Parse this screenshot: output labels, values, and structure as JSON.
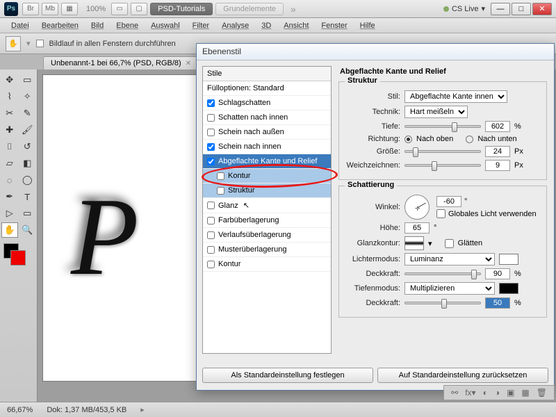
{
  "titlebar": {
    "zoom": "100%",
    "workspace_active": "PSD-Tutorials",
    "workspace_other": "Grundelemente",
    "cslive": "CS Live"
  },
  "menu": [
    "Datei",
    "Bearbeiten",
    "Bild",
    "Ebene",
    "Auswahl",
    "Filter",
    "Analyse",
    "3D",
    "Ansicht",
    "Fenster",
    "Hilfe"
  ],
  "options": {
    "scroll_all": "Bildlauf in allen Fenstern durchführen"
  },
  "doc": {
    "tab": "Unbenannt-1 bei 66,7% (PSD, RGB/8)"
  },
  "dialog": {
    "title": "Ebenenstil",
    "list_header": "Stile",
    "fill_opts": "Fülloptionen: Standard",
    "items": {
      "drop_shadow": "Schlagschatten",
      "inner_shadow": "Schatten nach innen",
      "outer_glow": "Schein nach außen",
      "inner_glow": "Schein nach innen",
      "bevel": "Abgeflachte Kante und Relief",
      "contour_sub": "Kontur",
      "texture_sub": "Struktur",
      "satin": "Glanz",
      "color_overlay": "Farbüberlagerung",
      "grad_overlay": "Verlaufsüberlagerung",
      "pat_overlay": "Musterüberlagerung",
      "stroke": "Kontur"
    },
    "right": {
      "heading": "Abgeflachte Kante und Relief",
      "g1": "Struktur",
      "style_lab": "Stil:",
      "style_val": "Abgeflachte Kante innen",
      "tech_lab": "Technik:",
      "tech_val": "Hart meißeln",
      "depth_lab": "Tiefe:",
      "depth_val": "602",
      "dir_lab": "Richtung:",
      "dir_up": "Nach oben",
      "dir_down": "Nach unten",
      "size_lab": "Größe:",
      "size_val": "24",
      "soft_lab": "Weichzeichnen:",
      "soft_val": "9",
      "pct": "%",
      "px": "Px",
      "deg": "°",
      "g2": "Schattierung",
      "angle_lab": "Winkel:",
      "angle_val": "-60",
      "global": "Globales Licht verwenden",
      "alt_lab": "Höhe:",
      "alt_val": "65",
      "gc_lab": "Glanzkontur:",
      "aa": "Glätten",
      "hmode_lab": "Lichtermodus:",
      "hmode_val": "Luminanz",
      "hop_lab": "Deckkraft:",
      "hop_val": "90",
      "smode_lab": "Tiefenmodus:",
      "smode_val": "Multiplizieren",
      "sop_lab": "Deckkraft:",
      "sop_val": "50"
    },
    "btn_default": "Als Standardeinstellung festlegen",
    "btn_reset": "Auf Standardeinstellung zurücksetzen"
  },
  "status": {
    "zoom": "66,67%",
    "doc": "Dok: 1,37 MB/453,5 KB"
  }
}
